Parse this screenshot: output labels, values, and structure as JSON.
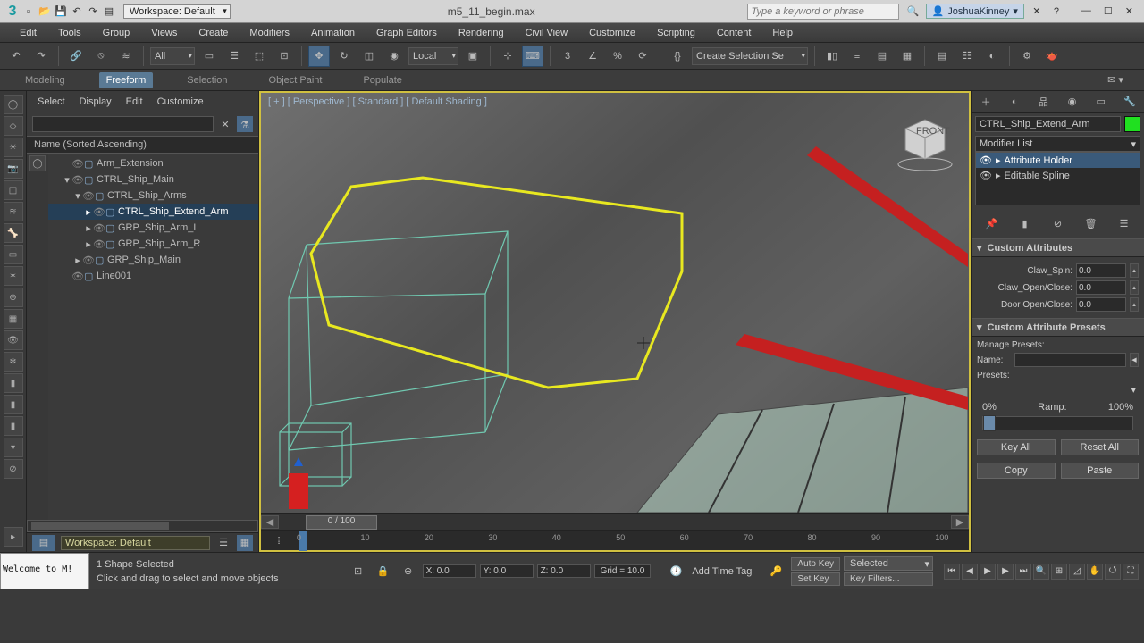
{
  "titlebar": {
    "workspace_label": "Workspace: Default",
    "filename": "m5_11_begin.max",
    "search_placeholder": "Type a keyword or phrase",
    "user_name": "JoshuaKinney"
  },
  "menubar": [
    "Edit",
    "Tools",
    "Group",
    "Views",
    "Create",
    "Modifiers",
    "Animation",
    "Graph Editors",
    "Rendering",
    "Civil View",
    "Customize",
    "Scripting",
    "Content",
    "Help"
  ],
  "maintoolbar": {
    "filter_dd": "All",
    "coord_sys": "Local",
    "selection_set": "Create Selection Se"
  },
  "ribbon_tabs": [
    "Modeling",
    "Freeform",
    "Selection",
    "Object Paint",
    "Populate"
  ],
  "ribbon_active": "Freeform",
  "scene_panel": {
    "tabs": [
      "Select",
      "Display",
      "Edit",
      "Customize"
    ],
    "header": "Name (Sorted Ascending)",
    "workspace_footer": "Workspace: Default",
    "tree": [
      {
        "indent": 1,
        "tw": "",
        "name": "Arm_Extension",
        "sel": false
      },
      {
        "indent": 1,
        "tw": "▾",
        "name": "CTRL_Ship_Main",
        "sel": false
      },
      {
        "indent": 2,
        "tw": "▾",
        "name": "CTRL_Ship_Arms",
        "sel": false
      },
      {
        "indent": 3,
        "tw": "▸",
        "name": "CTRL_Ship_Extend_Arm",
        "sel": true
      },
      {
        "indent": 3,
        "tw": "▸",
        "name": "GRP_Ship_Arm_L",
        "sel": false
      },
      {
        "indent": 3,
        "tw": "▸",
        "name": "GRP_Ship_Arm_R",
        "sel": false
      },
      {
        "indent": 2,
        "tw": "▸",
        "name": "GRP_Ship_Main",
        "sel": false
      },
      {
        "indent": 1,
        "tw": "",
        "name": "Line001",
        "sel": false
      }
    ]
  },
  "viewport": {
    "label": "[ + ] [ Perspective ] [ Standard ] [ Default Shading ]",
    "time_slider": "0 / 100",
    "timeline_ticks": [
      "0",
      "10",
      "20",
      "30",
      "40",
      "50",
      "60",
      "70",
      "80",
      "90",
      "100"
    ]
  },
  "cmd": {
    "obj_name": "CTRL_Ship_Extend_Arm",
    "modifier_list_label": "Modifier List",
    "stack": [
      {
        "name": "Attribute Holder",
        "sel": true
      },
      {
        "name": "Editable Spline",
        "sel": false
      }
    ],
    "rollout_attr_title": "Custom Attributes",
    "attrs": [
      {
        "label": "Claw_Spin:",
        "value": "0.0"
      },
      {
        "label": "Claw_Open/Close:",
        "value": "0.0"
      },
      {
        "label": "Door Open/Close:",
        "value": "0.0"
      }
    ],
    "rollout_presets_title": "Custom Attribute Presets",
    "presets_manage": "Manage Presets:",
    "presets_name": "Name:",
    "presets_label": "Presets:",
    "ramp_0": "0%",
    "ramp_label": "Ramp:",
    "ramp_100": "100%",
    "btn_keyall": "Key All",
    "btn_resetall": "Reset All",
    "btn_copy": "Copy",
    "btn_paste": "Paste"
  },
  "status": {
    "script_text": "Welcome to M!",
    "sel_line": "1 Shape Selected",
    "prompt_line": "Click and drag to select and move objects",
    "x": "X: 0.0",
    "y": "Y: 0.0",
    "z": "Z: 0.0",
    "grid": "Grid = 10.0",
    "add_time_tag": "Add Time Tag",
    "auto_key": "Auto Key",
    "set_key": "Set Key",
    "selected_dd": "Selected",
    "key_filters": "Key Filters..."
  }
}
